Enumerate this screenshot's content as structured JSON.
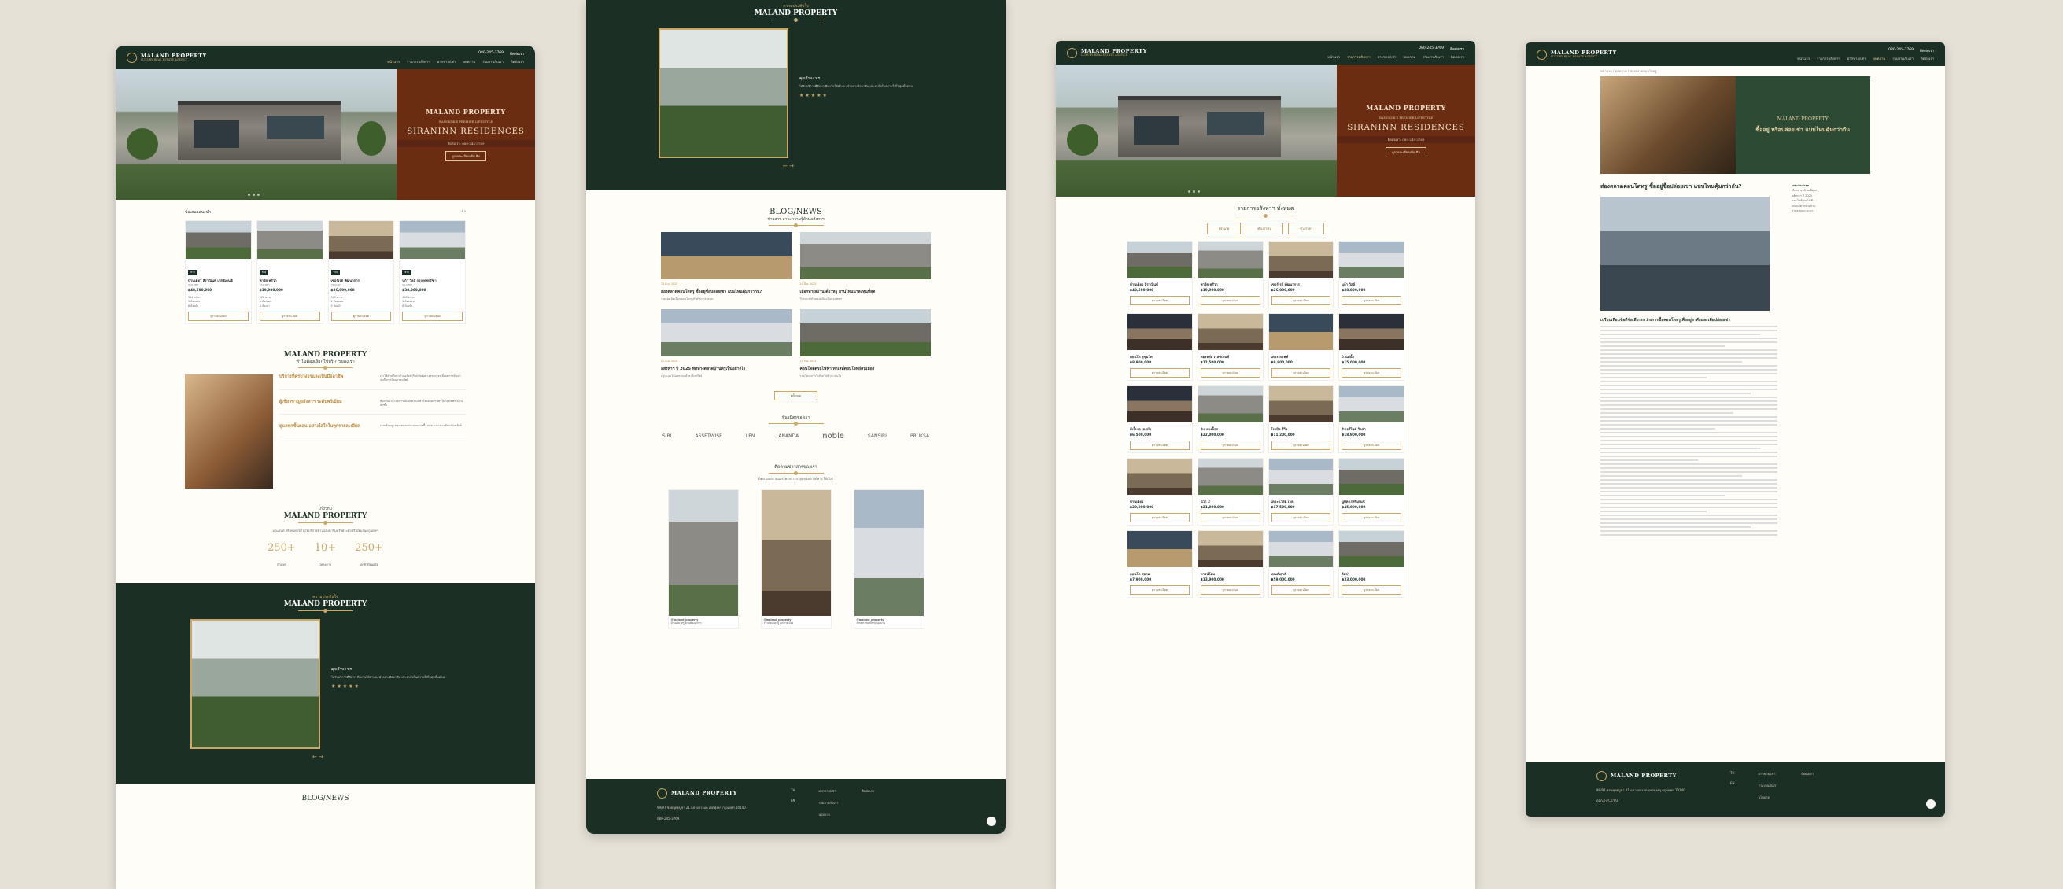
{
  "brand": {
    "name": "MALAND PROPERTY",
    "tagline": "LUXURY REAL ESTATE AGENCY"
  },
  "header": {
    "phone": "080-245-3769",
    "line": "ติดต่อเรา",
    "nav": [
      "หน้าแรก",
      "รายการอสังหาฯ",
      "ฝากขาย/เช่า",
      "บทความ",
      "ร่วมงานกับเรา",
      "ติดต่อเรา"
    ]
  },
  "hero": {
    "brand": "MALAND PROPERTY",
    "subtitle": "BANGKOK'S PREMIER LIFESTYLE",
    "project": "SIRANINN RESIDENCES",
    "bar": "ติดต่อเรา: 080-245-3769",
    "cta": "ดูรายละเอียดเพิ่มเติม"
  },
  "panel1": {
    "recommended_title": "ข้อเสนอแนะนำ",
    "cards": [
      {
        "tag": "ขาย",
        "name": "บ้านเดี่ยว สิราณินท์ เรสซิเดนซ์",
        "loc": "กรุงเทพฯ",
        "price": "฿48,500,000",
        "m1": "554 ตร.ม.",
        "m2": "5 ห้องนอน",
        "m3": "6 ห้องน้ำ",
        "btn": "ดูรายละเอียด"
      },
      {
        "tag": "ขาย",
        "name": "พาร์ค พริวา",
        "loc": "กรุงเทพฯ",
        "price": "฿19,900,000",
        "m1": "320 ตร.ม.",
        "m2": "4 ห้องนอน",
        "m3": "4 ห้องน้ำ",
        "btn": "ดูรายละเอียด"
      },
      {
        "tag": "ขาย",
        "name": "เซอร์เรย์ พัฒนาการ",
        "loc": "กรุงเทพฯ",
        "price": "฿26,000,000",
        "m1": "345 ตร.ม.",
        "m2": "4 ห้องนอน",
        "m3": "5 ห้องน้ำ",
        "btn": "ดูรายละเอียด"
      },
      {
        "tag": "ขาย",
        "name": "บูก้า วิลล์ กรุงเทพกรีฑา",
        "loc": "กรุงเทพฯ",
        "price": "฿38,000,000",
        "m1": "498 ตร.ม.",
        "m2": "5 ห้องนอน",
        "m3": "6 ห้องน้ำ",
        "btn": "ดูรายละเอียด"
      }
    ],
    "why_brand": "MALAND PROPERTY",
    "why_title": "ทำไมต้องเลือกใช้บริการของเรา",
    "why_items": [
      {
        "h": "บริการที่ครบวงจรและเป็นมืออาชีพ",
        "p": "เราให้คำปรึกษาด้านอสังหาริมทรัพย์อย่างครบวงจร ตั้งแต่การค้นหา จนถึงการโอนกรรมสิทธิ์"
      },
      {
        "h": "ผู้เชี่ยวชาญอสังหาฯ ระดับพรีเมียม",
        "p": "ทีมงานมีประสบการณ์และความเข้าใจตลาดบ้านหรูในกรุงเทพฯ อย่างลึกซึ้ง"
      },
      {
        "h": "ดูแลทุกขั้นตอน อย่างใส่ใจในทุกรายละเอียด",
        "p": "เราพร้อมดูแลคุณตลอดกระบวนการซื้อ ขาย และเช่าอสังหาริมทรัพย์"
      }
    ],
    "about_small": "เกี่ยวกับ",
    "about_brand": "MALAND PROPERTY",
    "about_text": "มาแลนด์ พร็อพเพอร์ตี้ ผู้ให้บริการด้านอสังหาริมทรัพย์ระดับพรีเมียมในกรุงเทพฯ",
    "stats": [
      {
        "n": "250+",
        "l": "บ้านหรู"
      },
      {
        "n": "10+",
        "l": "โครงการ"
      },
      {
        "n": "250+",
        "l": "ลูกค้าพึงพอใจ"
      }
    ]
  },
  "review": {
    "small": "ความประทับใจ",
    "brand": "MALAND PROPERTY",
    "name": "คุณจำนง พร",
    "quote": "ได้รับบริการที่ดีมาก ทีมงานให้คำแนะนำอย่างมืออาชีพ ประทับใจในความใส่ใจทุกขั้นตอน",
    "stars": "★★★★★",
    "arrows": "← →"
  },
  "blog": {
    "title": "BLOG/NEWS",
    "subtitle": "ข่าวสาร สาระความรู้ด้านอสังหาฯ",
    "posts": [
      {
        "t": "ส่องตลาดคอนโดหรู ซื้ออยู่ซื้อปล่อยเช่า แบบไหนคุ้มกว่ากัน?",
        "d": "รวมเทคนิคเลือกคอนโดหรูสำหรับการลงทุน",
        "date": "15 มี.ค. 2025"
      },
      {
        "t": "เลือกทำเลบ้านเดี่ยวหรู ย่านไหนน่าลงทุนที่สุด",
        "d": "วิเคราะห์ทำเลยอดนิยมในกรุงเทพฯ",
        "date": "10 มี.ค. 2025"
      },
      {
        "t": "อสังหาฯ ปี 2025 ทิศทางตลาดบ้านหรูเป็นอย่างไร",
        "d": "สรุปแนวโน้มตลาดอสังหาริมทรัพย์",
        "date": "02 มี.ค. 2025"
      },
      {
        "t": "คอนโดติดรถไฟฟ้า ทำเลที่ตอบโจทย์คนเมือง",
        "d": "รวมโครงการใกล้รถไฟฟ้าน่าสนใจ",
        "date": "25 ก.พ. 2025"
      }
    ],
    "more": "ดูทั้งหมด"
  },
  "partners": {
    "title": "พันธมิตรของเรา",
    "list": [
      "SIRI",
      "ASSETWISE",
      "LPN",
      "ANANDA",
      "noble",
      "SANSIRI",
      "PRUKSA"
    ]
  },
  "social": {
    "title": "ติดตามข่าวสารของเรา",
    "text": "ติดตามผลงานและโครงการล่าสุดของเราได้ทาง TikTok",
    "posts": [
      {
        "user": "@maland_property",
        "cap": "บ้านเดี่ยวหรู ย่านพัฒนาการ"
      },
      {
        "user": "@maland_property",
        "cap": "รีวิวคอนโดหรูใจกลางเมือง"
      },
      {
        "user": "@maland_property",
        "cap": "Smart Home ทุกมุมบ้าน"
      }
    ]
  },
  "footer": {
    "address": "99/97 ซอยพุทธบูชา 21 แขวงบางมด เขตทุ่งครุ กรุงเทพฯ 10140",
    "phone": "080-245-3769",
    "col1": [
      "TH",
      "EN"
    ],
    "col2": [
      "ฝากขาย/เช่า",
      "ร่วมงานกับเรา",
      "นโยบาย"
    ],
    "line": "ติดต่อเรา"
  },
  "listing": {
    "title": "รายการอสังหาฯ ทั้งหมด",
    "filters": [
      "ประเภท",
      "ทำเล/โซน",
      "ช่วงราคา"
    ],
    "items": [
      {
        "n": "บ้านเดี่ยว สิราณินท์",
        "p": "฿48,500,000"
      },
      {
        "n": "พาร์ค พริวา",
        "p": "฿19,900,000"
      },
      {
        "n": "เซอร์เรย์ พัฒนาการ",
        "p": "฿26,000,000"
      },
      {
        "n": "บูก้า วิลล์",
        "p": "฿38,000,000"
      },
      {
        "n": "คอนโด สุขุมวิท",
        "p": "฿8,900,000"
      },
      {
        "n": "ทองหล่อ เรสซิเดนซ์",
        "p": "฿12,500,000"
      },
      {
        "n": "เดอะ ลอฟท์",
        "p": "฿9,800,000"
      },
      {
        "n": "วิวแม่น้ำ",
        "p": "฿15,000,000"
      },
      {
        "n": "ดีเอ็นเอ เอกมัย",
        "p": "฿6,500,000"
      },
      {
        "n": "วัน แบงค็อก",
        "p": "฿22,000,000"
      },
      {
        "n": "โนเบิล รีวีล",
        "p": "฿11,200,000"
      },
      {
        "n": "ริเวอร์ไซด์ วิลล่า",
        "p": "฿18,900,000"
      },
      {
        "n": "บ้านเดี่ยว",
        "p": "฿29,000,000"
      },
      {
        "n": "นิวา 2",
        "p": "฿21,000,000"
      },
      {
        "n": "เดอะ เวสต์ เวล",
        "p": "฿17,500,000"
      },
      {
        "n": "บูทีค เรสซิเดนซ์",
        "p": "฿45,000,000"
      },
      {
        "n": "คอนโด สยาม",
        "p": "฿7,900,000"
      },
      {
        "n": "ทาวน์โฮม",
        "p": "฿13,900,000"
      },
      {
        "n": "เพนท์เฮาส์",
        "p": "฿59,000,000"
      },
      {
        "n": "วิลล่า",
        "p": "฿33,000,000"
      }
    ],
    "btn": "ดูรายละเอียด"
  },
  "article": {
    "crumb": "หน้าแรก / บทความ / ส่องตลาดคอนโดหรู",
    "title": "ส่องตลาดคอนโดหรู ซื้ออยู่ซื้อปล่อยเช่า แบบไหนคุ้มกว่ากัน?",
    "banner": "ซื้ออยู่ หรือปล่อยเช่า แบบไหนคุ้มกว่ากัน",
    "lead": "เปรียบเทียบข้อดีข้อเสียระหว่างการซื้อคอนโดหรูเพื่ออยู่อาศัยและเพื่อปล่อยเช่า",
    "side_title": "บทความล่าสุด",
    "side": [
      "เลือกทำเลบ้านเดี่ยวหรู",
      "อสังหาฯ ปี 2025",
      "คอนโดติดรถไฟฟ้า",
      "เทคนิคฝากขายบ้าน",
      "การลงทุนระยะยาว"
    ]
  }
}
